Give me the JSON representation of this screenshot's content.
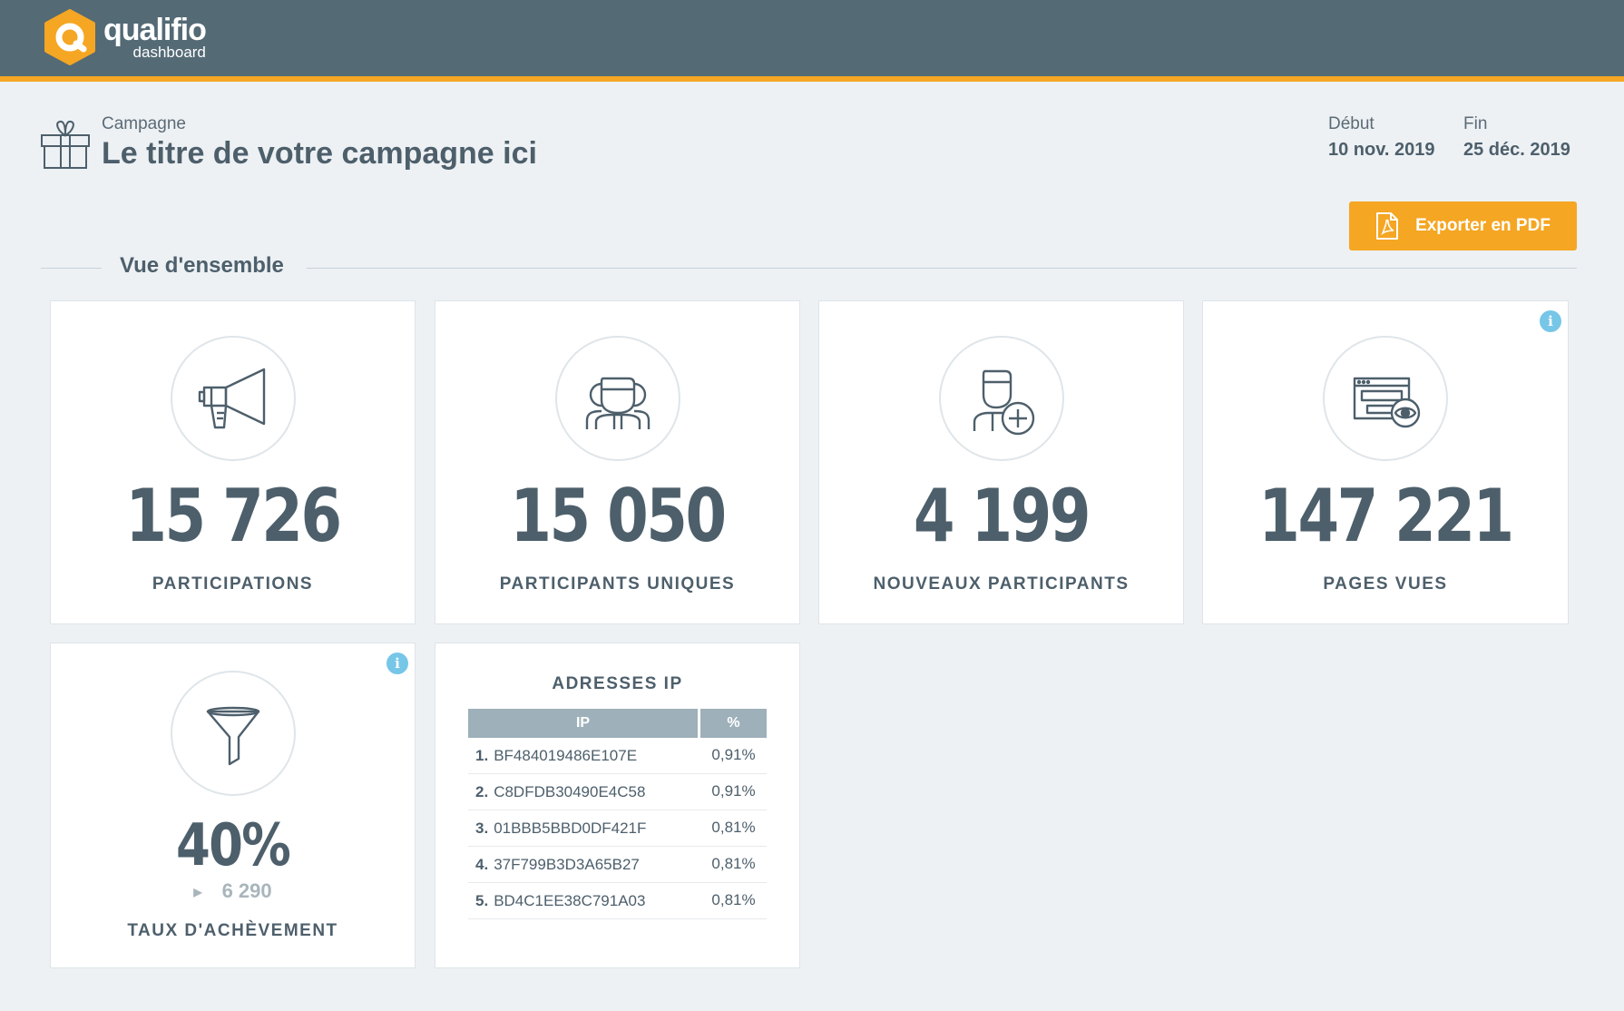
{
  "brand": {
    "name": "qualifio",
    "sub": "dashboard",
    "accent": "#f5a623",
    "header_bg": "#546a75"
  },
  "campaign": {
    "label": "Campagne",
    "title": "Le titre de votre campagne ici",
    "start_label": "Début",
    "start_value": "10 nov. 2019",
    "end_label": "Fin",
    "end_value": "25 déc. 2019"
  },
  "actions": {
    "export_label": "Exporter en PDF"
  },
  "overview": {
    "title": "Vue d'ensemble"
  },
  "stats": [
    {
      "icon": "megaphone-icon",
      "value": "15 726",
      "label": "PARTICIPATIONS"
    },
    {
      "icon": "users-icon",
      "value": "15 050",
      "label": "PARTICIPANTS UNIQUES"
    },
    {
      "icon": "add-user-icon",
      "value": "4 199",
      "label": "NOUVEAUX PARTICIPANTS"
    },
    {
      "icon": "browser-eye-icon",
      "value": "147 221",
      "label": "PAGES VUES",
      "info": "i"
    }
  ],
  "completion": {
    "icon": "funnel-icon",
    "value": "40%",
    "sub_value": "6 290",
    "label": "TAUX D'ACHÈVEMENT",
    "info": "i"
  },
  "ip_table": {
    "title": "ADRESSES IP",
    "headers": [
      "IP",
      "%"
    ],
    "rows": [
      {
        "rank": "1.",
        "ip": "BF484019486E107E",
        "pct": "0,91%"
      },
      {
        "rank": "2.",
        "ip": "C8DFDB30490E4C58",
        "pct": "0,91%"
      },
      {
        "rank": "3.",
        "ip": "01BBB5BBD0DF421F",
        "pct": "0,81%"
      },
      {
        "rank": "4.",
        "ip": "37F799B3D3A65B27",
        "pct": "0,81%"
      },
      {
        "rank": "5.",
        "ip": "BD4C1EE38C791A03",
        "pct": "0,81%"
      }
    ]
  }
}
